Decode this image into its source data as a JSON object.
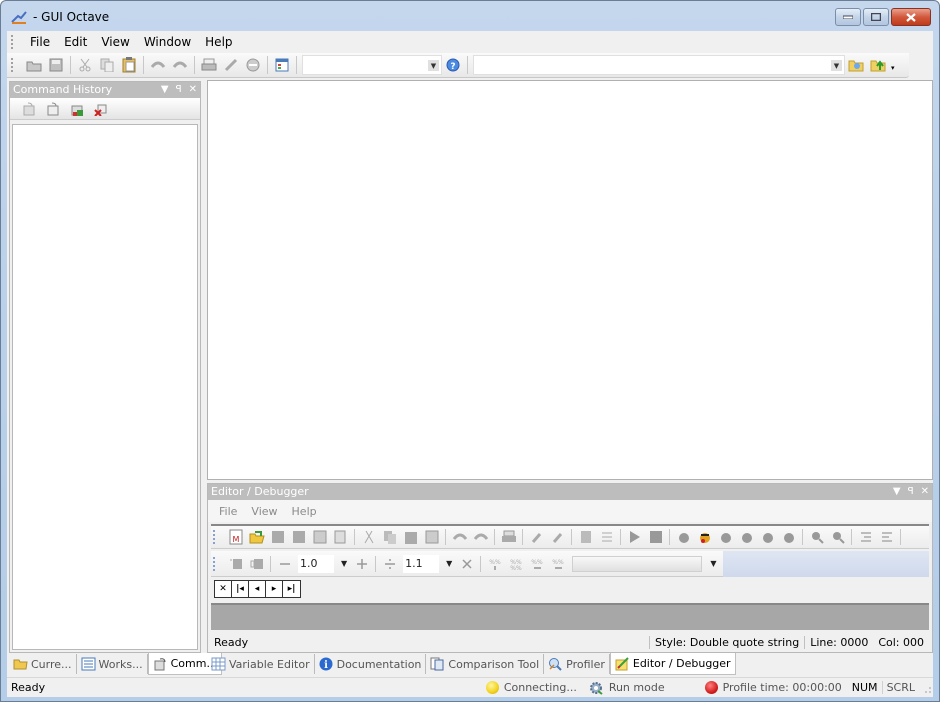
{
  "window": {
    "title": " - GUI Octave",
    "icon": "octave-app-icon",
    "controls": [
      "minimize",
      "maximize",
      "close"
    ]
  },
  "menubar": {
    "items": [
      "File",
      "Edit",
      "View",
      "Window",
      "Help"
    ]
  },
  "toolbar": {
    "icons": [
      "open-folder-icon",
      "save-icon",
      "cut-icon",
      "copy-icon",
      "paste-icon",
      "undo-icon",
      "redo-icon",
      "print-icon",
      "plug-icon",
      "stop-icon",
      "options-icon"
    ],
    "command_combo_value": "",
    "help_icon": "help-icon",
    "directory_combo_value": "",
    "browse_folder_icon": "browse-folder-icon",
    "parent_folder_icon": "folder-up-icon"
  },
  "command_history": {
    "title": "Command History",
    "tools": [
      "run-history-icon",
      "copy-history-icon",
      "save-history-icon",
      "delete-history-icon"
    ]
  },
  "left_tabs": [
    {
      "label": "Curre...",
      "icon": "folder-icon",
      "active": false
    },
    {
      "label": "Works...",
      "icon": "workspace-icon",
      "active": false
    },
    {
      "label": "Comm...",
      "icon": "command-history-icon",
      "active": true
    }
  ],
  "editor": {
    "title": "Editor / Debugger",
    "menu": [
      "File",
      "View",
      "Help"
    ],
    "zoom_value": "1.0",
    "spacing_value": "1.1",
    "style_combo_value": "",
    "nav_buttons": [
      "close",
      "first",
      "prev",
      "next",
      "last"
    ],
    "status": {
      "message": "Ready",
      "style": "Style: Double quote string",
      "line": "Line: 0000",
      "col": "Col: 000"
    }
  },
  "bottom_tabs": [
    {
      "label": "Variable Editor",
      "icon": "grid-icon",
      "active": false
    },
    {
      "label": "Documentation",
      "icon": "info-icon",
      "active": false
    },
    {
      "label": "Comparison Tool",
      "icon": "compare-icon",
      "active": false
    },
    {
      "label": "Profiler",
      "icon": "profiler-icon",
      "active": false
    },
    {
      "label": "Editor / Debugger",
      "icon": "editor-icon",
      "active": true
    }
  ],
  "statusbar": {
    "message": "Ready",
    "connection": "Connecting...",
    "mode": "Run mode",
    "profile_time": "Profile time: 00:00:00",
    "num": "NUM",
    "scrl": "SCRL",
    "colors": {
      "connecting": "#f2d21b",
      "profile": "#d42020"
    }
  }
}
